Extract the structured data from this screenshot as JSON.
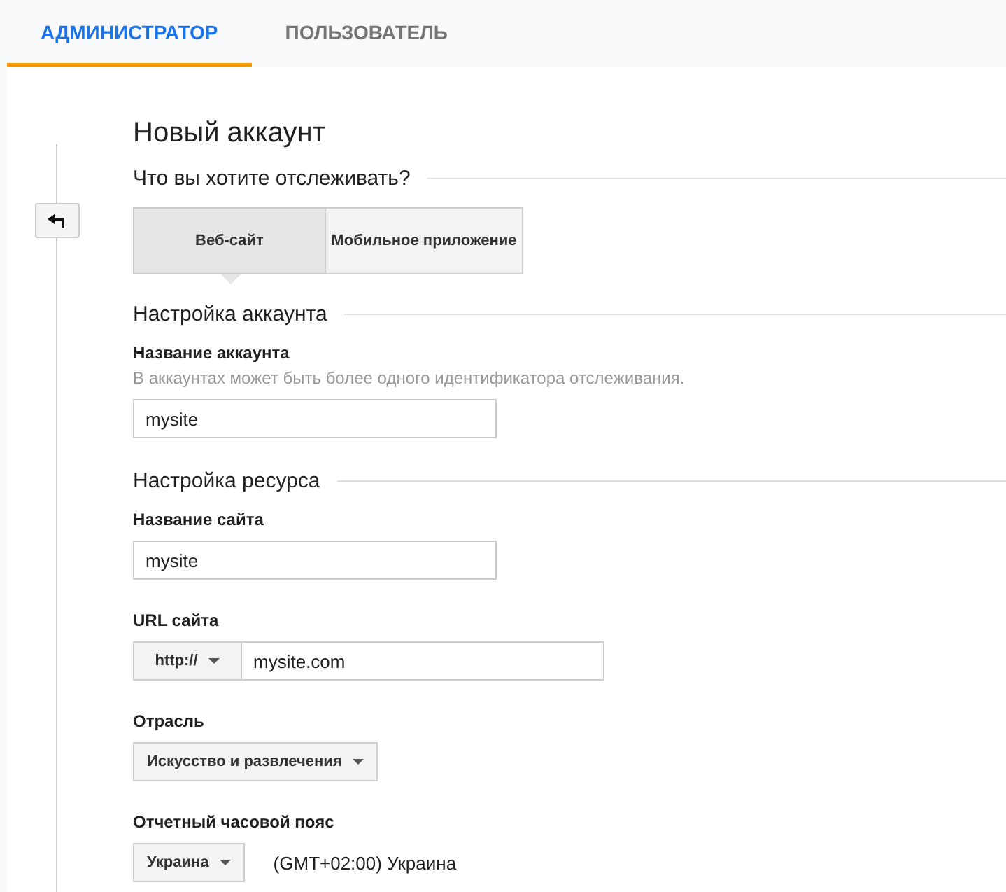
{
  "tabs": [
    {
      "label": "АДМИНИСТРАТОР",
      "selected": true
    },
    {
      "label": "ПОЛЬЗОВАТЕЛЬ",
      "selected": false
    }
  ],
  "title": "Новый аккаунт",
  "tracking": {
    "heading": "Что вы хотите отслеживать?",
    "options": [
      {
        "label": "Веб-сайт",
        "selected": true
      },
      {
        "label": "Мобильное приложение",
        "selected": false
      }
    ]
  },
  "sections": [
    {
      "heading": "Настройка аккаунта",
      "fields": [
        {
          "kind": "text",
          "label": "Название аккаунта",
          "hint": "В аккаунтах может быть более одного идентификатора отслеживания.",
          "value": "mysite"
        }
      ]
    },
    {
      "heading": "Настройка ресурса",
      "fields": [
        {
          "kind": "text",
          "label": "Название сайта",
          "value": "mysite"
        },
        {
          "kind": "url",
          "label": "URL сайта",
          "protocol": "http://",
          "value": "mysite.com"
        },
        {
          "kind": "select",
          "label": "Отрасль",
          "value": "Искусство и развлечения"
        },
        {
          "kind": "timezone",
          "label": "Отчетный часовой пояс",
          "country": "Украина",
          "zone": "(GMT+02:00) Украина"
        }
      ]
    }
  ]
}
